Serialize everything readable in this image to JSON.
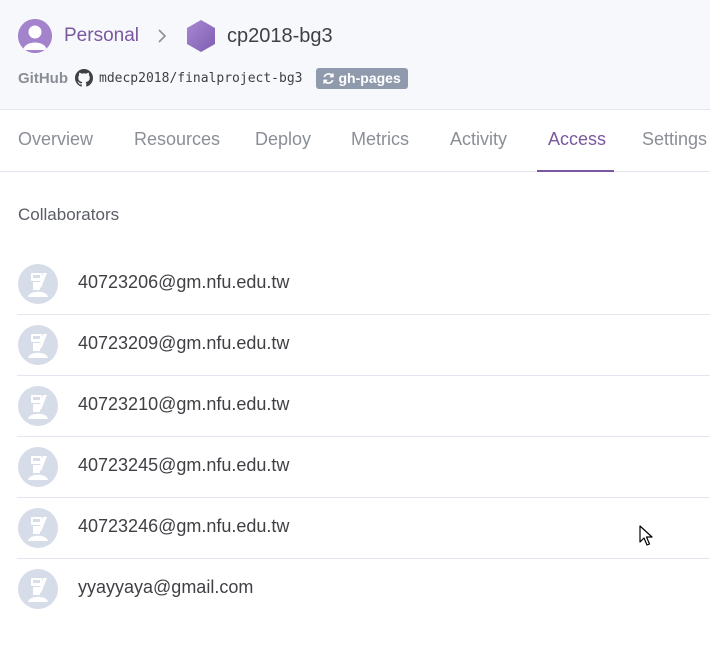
{
  "header": {
    "breadcrumb": {
      "personal_label": "Personal",
      "app_name": "cp2018-bg3"
    },
    "github": {
      "label": "GitHub",
      "repo": "mdecp2018/finalproject-bg3",
      "branch": "gh-pages"
    }
  },
  "tabs": [
    {
      "label": "Overview",
      "active": false
    },
    {
      "label": "Resources",
      "active": false
    },
    {
      "label": "Deploy",
      "active": false
    },
    {
      "label": "Metrics",
      "active": false
    },
    {
      "label": "Activity",
      "active": false
    },
    {
      "label": "Access",
      "active": true
    },
    {
      "label": "Settings",
      "active": false
    }
  ],
  "access": {
    "section_title": "Collaborators",
    "collaborators": [
      {
        "email": "40723206@gm.nfu.edu.tw"
      },
      {
        "email": "40723209@gm.nfu.edu.tw"
      },
      {
        "email": "40723210@gm.nfu.edu.tw"
      },
      {
        "email": "40723245@gm.nfu.edu.tw"
      },
      {
        "email": "40723246@gm.nfu.edu.tw"
      },
      {
        "email": "yyayyaya@gmail.com"
      }
    ]
  },
  "colors": {
    "accent_purple": "#79589f",
    "header_bg": "#f7f8fb",
    "badge_bg": "#8f9aac",
    "avatar_placeholder": "#d6dde8",
    "divider": "#e3e6ee"
  },
  "icons": {
    "personal_avatar": "user-avatar-icon",
    "separator": "chevron-right-icon",
    "app": "hexagon-app-icon",
    "github": "github-icon",
    "branch": "sync-icon",
    "collaborator": "default-avatar-icon",
    "cursor": "mouse-pointer-icon"
  }
}
